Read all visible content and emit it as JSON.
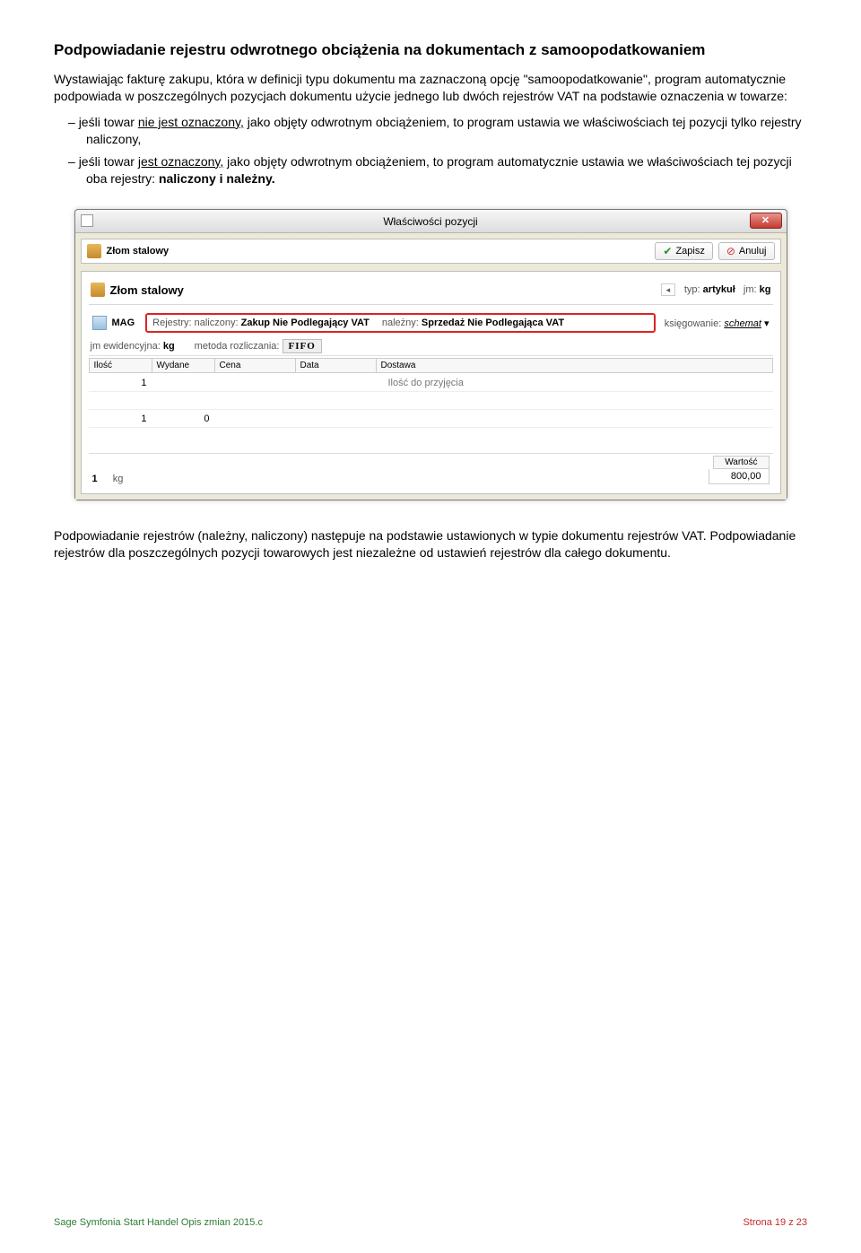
{
  "heading": "Podpowiadanie rejestru odwrotnego obciążenia na dokumentach z samoopodatkowaniem",
  "para1": "Wystawiając fakturę zakupu, która w definicji typu dokumentu ma zaznaczoną opcję \"samoopodatkowanie\", program automatycznie podpowiada w poszczególnych pozycjach dokumentu użycie jednego lub dwóch rejestrów VAT na podstawie oznaczenia w towarze:",
  "bullet1_a": "jeśli towar ",
  "bullet1_u": "nie jest oznaczony,",
  "bullet1_b": " jako objęty odwrotnym obciążeniem, to program ustawia we właściwościach tej pozycji tylko rejestry naliczony,",
  "bullet2_a": "jeśli towar ",
  "bullet2_u": "jest oznaczony,",
  "bullet2_b": " jako objęty odwrotnym obciążeniem, to program automatycznie ustawia we właściwościach tej pozycji oba rejestry: ",
  "bullet2_bold": "naliczony i należny.",
  "para2": "Podpowiadanie rejestrów (należny, naliczony) następuje na podstawie ustawionych w typie dokumentu rejestrów VAT. Podpowiadanie rejestrów dla poszczególnych pozycji towarowych jest niezależne od ustawień rejestrów dla całego dokumentu.",
  "window": {
    "title": "Właściwości pozycji",
    "close": "✕",
    "item_code": "Złom stalowy",
    "zapisz": "Zapisz",
    "anuluj": "Anuluj",
    "item_name": "Złom stalowy",
    "typ_label": "typ:",
    "typ_value": "artykuł",
    "jm_label": "jm:",
    "jm_value": "kg",
    "mag": "MAG",
    "rejestry_lbl": "Rejestry: naliczony:",
    "rejestry_val1": "Zakup Nie Podlegający VAT",
    "nalezny_lbl": "należny:",
    "nalezny_val": "Sprzedaż Nie Podlegająca VAT",
    "ksieg_lbl": "księgowanie:",
    "ksieg_val": "schemat",
    "jmew_lbl": "jm ewidencyjna:",
    "jmew_val": "kg",
    "metoda_lbl": "metoda rozliczania:",
    "metoda_val": "FIFO",
    "cols": [
      "Ilość",
      "Wydane",
      "Cena",
      "Data",
      "Dostawa"
    ],
    "row1": [
      "1",
      "",
      "",
      "",
      "Ilość do przyjęcia"
    ],
    "row2": [
      "1",
      "0",
      "",
      "",
      ""
    ],
    "sum_qty": "1",
    "sum_unit": "kg",
    "wartosc_lbl": "Wartość",
    "wartosc_val": "800,00"
  },
  "footer_left": "Sage Symfonia Start Handel Opis zmian 2015.c",
  "footer_right": "Strona 19 z 23"
}
